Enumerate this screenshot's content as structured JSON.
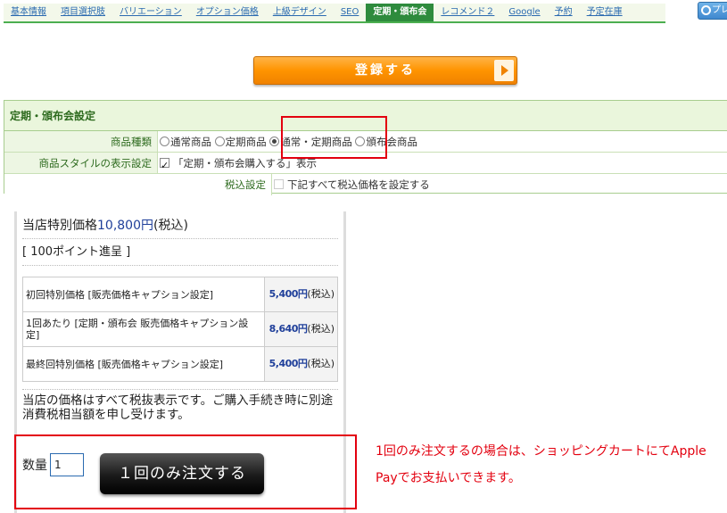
{
  "tabs": [
    {
      "label": "基本情報",
      "active": false
    },
    {
      "label": "項目選択肢",
      "active": false
    },
    {
      "label": "バリエーション",
      "active": false
    },
    {
      "label": "オプション価格",
      "active": false
    },
    {
      "label": "上級デザイン",
      "active": false
    },
    {
      "label": "SEO",
      "active": false
    },
    {
      "label": "定期・頒布会",
      "active": true
    },
    {
      "label": "レコメンド２",
      "active": false
    },
    {
      "label": "Google",
      "active": false
    },
    {
      "label": "予約",
      "active": false
    },
    {
      "label": "予定在庫",
      "active": false
    }
  ],
  "preview_button": {
    "label": "プレ",
    "icon": "search-icon"
  },
  "register_button": {
    "label": "登録する",
    "icon": "arrow-right-icon"
  },
  "settings": {
    "title": "定期・頒布会設定",
    "product_type": {
      "label": "商品種類",
      "options": [
        "通常商品",
        "定期商品",
        "通常・定期商品",
        "頒布会商品"
      ],
      "selected": "通常・定期商品"
    },
    "display_style": {
      "label": "商品スタイルの表示設定",
      "checked": true,
      "text": "「定期・頒布会購入する」表示"
    },
    "tax": {
      "label": "税込設定",
      "checked": false,
      "text": "下記すべて税込価格を設定する"
    }
  },
  "preview": {
    "price_prefix": "当店特別価格",
    "price_value": "10,800円",
    "price_suffix": "(税込)",
    "points": "[ 100ポイント進呈 ]",
    "price_rows": [
      {
        "name": "初回特別価格 [販売価格キャプション設定]",
        "price": "5,400円",
        "tax": "(税込)"
      },
      {
        "name": "1回あたり [定期・頒布会 販売価格キャプション設定]",
        "price": "8,640円",
        "tax": "(税込)"
      },
      {
        "name": "最終回特別価格 [販売価格キャプション設定]",
        "price": "5,400円",
        "tax": "(税込)"
      }
    ],
    "note": "当店の価格はすべて税抜表示です。ご購入手続き時に別途消費税相当額を申し受けます。",
    "quantity_label": "数量",
    "quantity_value": "1",
    "order_button": "１回のみ注文する"
  },
  "annotation": "1回のみ注文するの場合は、ショッピングカートにてApple Payでお支払いできます。",
  "colors": {
    "highlight": "#e3000f",
    "tab_active": "#2e8b3d",
    "register": "#ff9400"
  }
}
